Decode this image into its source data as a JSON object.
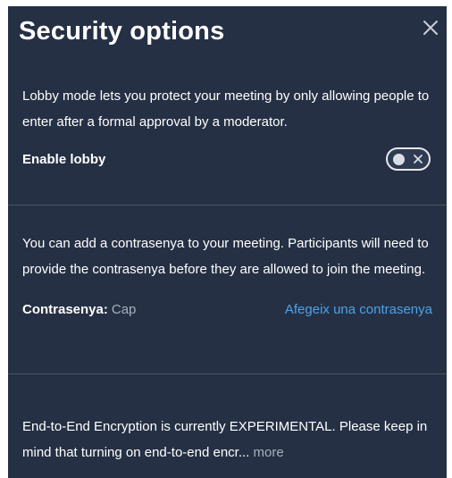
{
  "dialog": {
    "title": "Security options",
    "close_icon": "close-icon"
  },
  "lobby": {
    "description": "Lobby mode lets you protect your meeting by only allowing people to enter after a formal approval by a moderator.",
    "label": "Enable lobby",
    "enabled": false,
    "toggle_icon": "toggle-off-icon"
  },
  "password": {
    "description": "You can add a contrasenya to your meeting. Participants will need to provide the contrasenya before they are allowed to join the meeting.",
    "label": "Contrasenya:",
    "value": "Cap",
    "add_link": "Afegeix una contrasenya"
  },
  "e2ee": {
    "description": "End-to-End Encryption is currently EXPERIMENTAL. Please keep in mind that turning on end-to-end encr...",
    "more_link": "more"
  },
  "colors": {
    "panel_background": "#253044",
    "link": "#4ea2e8",
    "muted_text": "#a8b0bd",
    "divider": "#4a5566"
  }
}
